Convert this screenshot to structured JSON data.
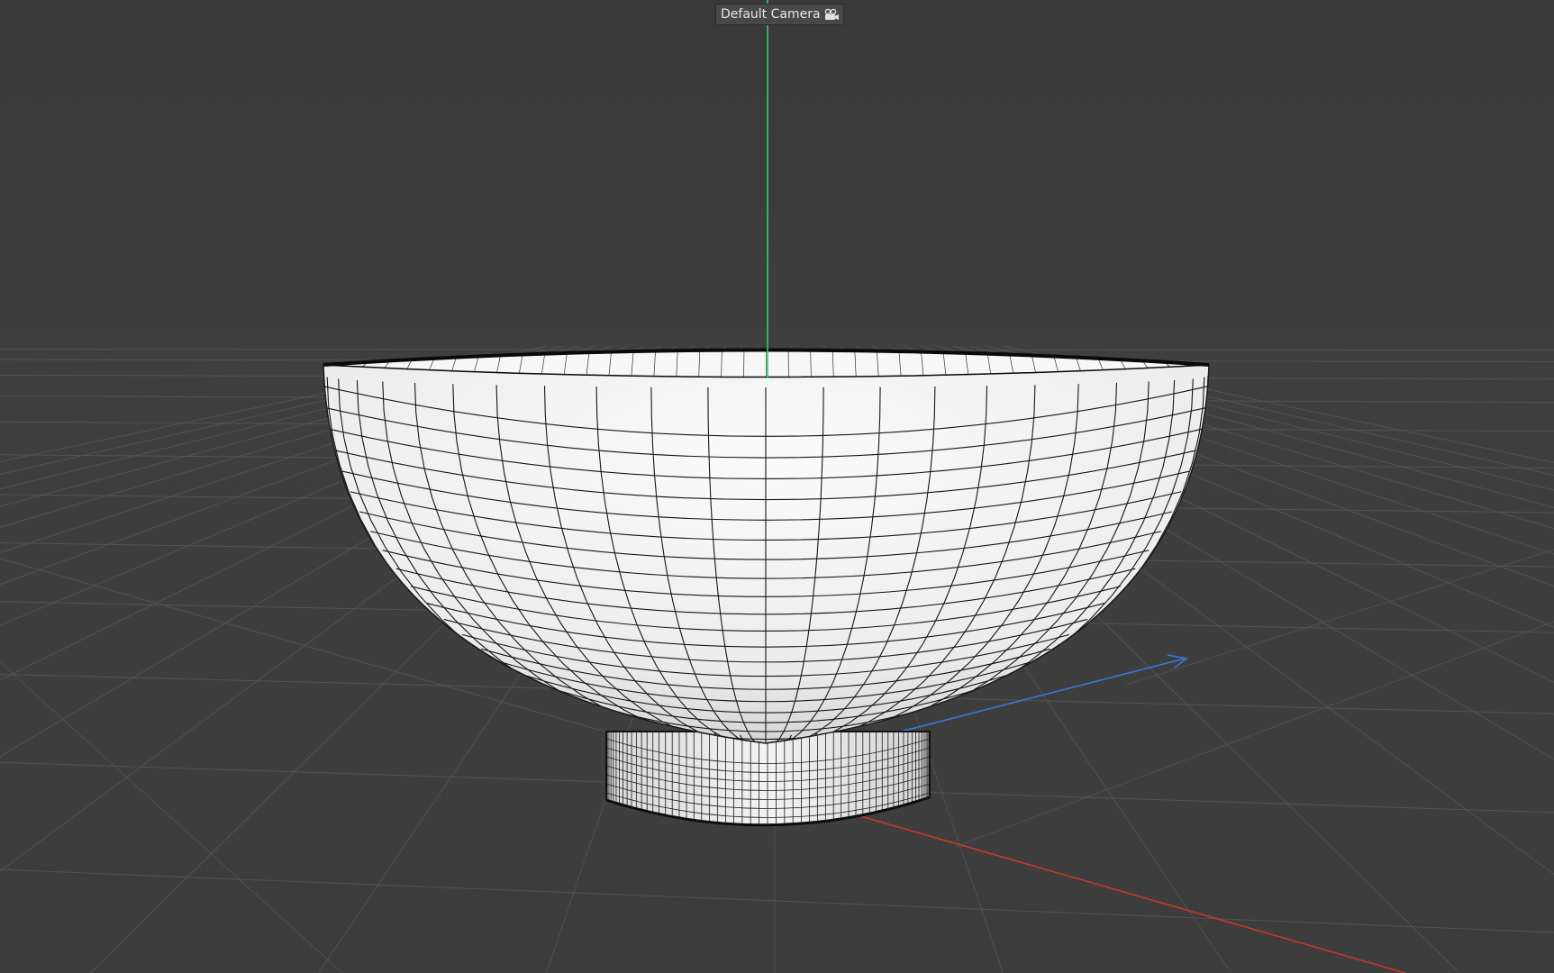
{
  "viewport": {
    "camera_label": "Default Camera",
    "camera_icon": "camera-icon",
    "colors": {
      "background_top": "#3a3a3a",
      "background_bottom": "#404040",
      "grid": "#555555",
      "axis_x": "#c0392b",
      "axis_y": "#2ecc71",
      "axis_z": "#3a78d8",
      "mesh_fill": "#ededed",
      "wire": "#111111"
    }
  }
}
